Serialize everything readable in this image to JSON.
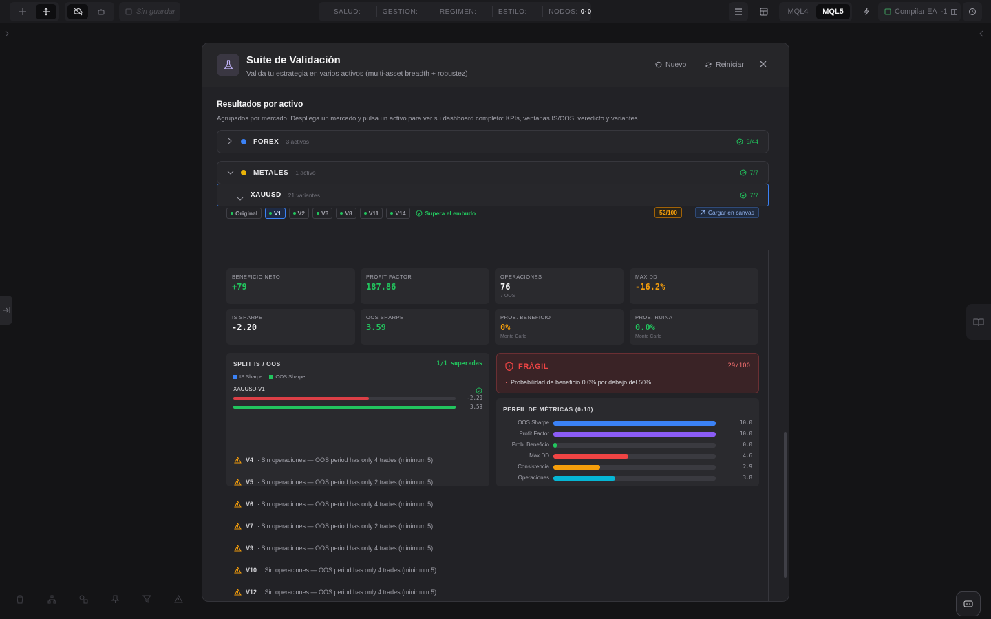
{
  "topbar": {
    "unsaved_label": "Sin guardar",
    "status": [
      {
        "label": "SALUD:",
        "value": "—"
      },
      {
        "label": "GESTIÓN:",
        "value": "—"
      },
      {
        "label": "RÉGIMEN:",
        "value": "—"
      },
      {
        "label": "ESTILO:",
        "value": "—"
      },
      {
        "label": "NODOS:",
        "value": "0·0"
      }
    ],
    "mql4": "MQL4",
    "mql5": "MQL5",
    "compile_label": "Compilar EA",
    "compile_count": "-1"
  },
  "modal": {
    "title": "Suite de Validación",
    "subtitle": "Valida tu estrategia en varios activos (multi-asset breadth + robustez)",
    "new_label": "Nuevo",
    "reset_label": "Reiniciar",
    "section_title": "Resultados por activo",
    "section_desc": "Agrupados por mercado. Despliega un mercado y pulsa un activo para ver su dashboard completo: KPIs, ventanas IS/OOS, veredicto y variantes."
  },
  "markets": [
    {
      "name": "FOREX",
      "count": "3 activos",
      "badge": "9/44",
      "color": "#3b82f6"
    },
    {
      "name": "METALES",
      "count": "1 activo",
      "badge": "7/7",
      "color": "#eab308"
    }
  ],
  "asset": {
    "name": "XAUUSD",
    "count": "21 variantes",
    "badge": "7/7"
  },
  "variants": [
    "Original",
    "V1",
    "V2",
    "V3",
    "V8",
    "V11",
    "V14"
  ],
  "funnel_label": "Supera el embudo",
  "score": "52/100",
  "load_canvas": "Cargar en canvas",
  "kpis": [
    {
      "label": "BENEFICIO NETO",
      "value": "+79",
      "sub": "",
      "color": "#22c55e"
    },
    {
      "label": "PROFIT FACTOR",
      "value": "187.86",
      "sub": "",
      "color": "#22c55e"
    },
    {
      "label": "OPERACIONES",
      "value": "76",
      "sub": "7 OOS",
      "color": "#f4f4f5"
    },
    {
      "label": "MAX DD",
      "value": "-16.2%",
      "sub": "",
      "color": "#f59e0b"
    },
    {
      "label": "IS SHARPE",
      "value": "-2.20",
      "sub": "",
      "color": "#f4f4f5"
    },
    {
      "label": "OOS SHARPE",
      "value": "3.59",
      "sub": "",
      "color": "#22c55e"
    },
    {
      "label": "PROB. BENEFICIO",
      "value": "0%",
      "sub": "Monte Carlo",
      "color": "#f59e0b"
    },
    {
      "label": "PROB. RUINA",
      "value": "0.0%",
      "sub": "Monte Carlo",
      "color": "#22c55e"
    }
  ],
  "split": {
    "title": "SPLIT IS / OOS",
    "result": "1/1 superadas",
    "legend_is": "IS Sharpe",
    "legend_oos": "OOS Sharpe",
    "row_name": "XAUUSD-V1",
    "is_value": "-2.20",
    "oos_value": "3.59",
    "is_fraction": 0.61,
    "oos_fraction": 1.0
  },
  "verdict": {
    "title": "FRÁGIL",
    "score": "29/100",
    "message": "Probabilidad de beneficio 0.0% por debajo del 50%."
  },
  "profile": {
    "title": "PERFIL DE MÉTRICAS (0-10)",
    "rows": [
      {
        "label": "OOS Sharpe",
        "value": "10.0",
        "score": 10.0,
        "color": "#3b82f6"
      },
      {
        "label": "Profit Factor",
        "value": "10.0",
        "score": 10.0,
        "color": "#8b5cf6"
      },
      {
        "label": "Prob. Beneficio",
        "value": "0.0",
        "score": 0.0,
        "color": "#22c55e"
      },
      {
        "label": "Max DD",
        "value": "4.6",
        "score": 4.6,
        "color": "#ef4444"
      },
      {
        "label": "Consistencia",
        "value": "2.9",
        "score": 2.9,
        "color": "#f59e0b"
      },
      {
        "label": "Operaciones",
        "value": "3.8",
        "score": 3.8,
        "color": "#06b6d4"
      }
    ]
  },
  "warnings": [
    {
      "variant": "V4",
      "text": "· Sin operaciones — OOS period has only 4 trades (minimum 5)"
    },
    {
      "variant": "V5",
      "text": "· Sin operaciones — OOS period has only 2 trades (minimum 5)"
    },
    {
      "variant": "V6",
      "text": "· Sin operaciones — OOS period has only 4 trades (minimum 5)"
    },
    {
      "variant": "V7",
      "text": "· Sin operaciones — OOS period has only 2 trades (minimum 5)"
    },
    {
      "variant": "V9",
      "text": "· Sin operaciones — OOS period has only 4 trades (minimum 5)"
    },
    {
      "variant": "V10",
      "text": "· Sin operaciones — OOS period has only 4 trades (minimum 5)"
    },
    {
      "variant": "V12",
      "text": "· Sin operaciones — OOS period has only 4 trades (minimum 5)"
    }
  ]
}
